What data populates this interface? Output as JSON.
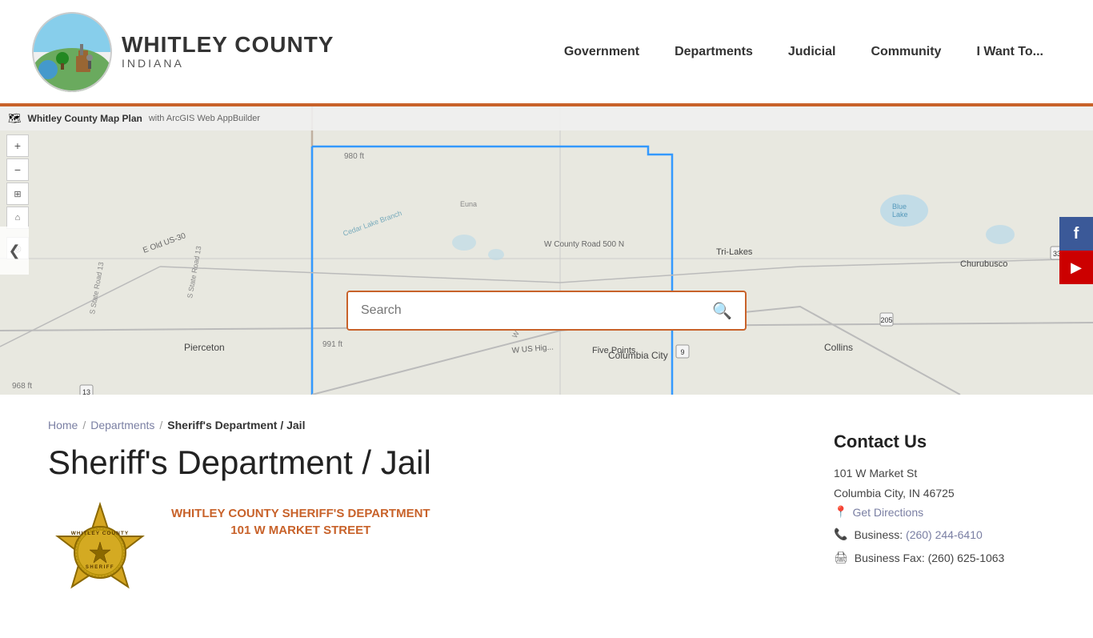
{
  "header": {
    "logo_county": "WHITLEY COUNTY",
    "logo_state": "INDIANA",
    "nav": [
      {
        "label": "Government",
        "href": "#"
      },
      {
        "label": "Departments",
        "href": "#"
      },
      {
        "label": "Judicial",
        "href": "#"
      },
      {
        "label": "Community",
        "href": "#"
      },
      {
        "label": "I Want To...",
        "href": "#"
      }
    ]
  },
  "map": {
    "arcgis_title": "Whitley County Map Plan",
    "arcgis_subtitle": "with ArcGIS Web AppBuilder",
    "prev_arrow": "❮",
    "zoom_in": "+",
    "zoom_out": "−",
    "controls": [
      "＋",
      "−",
      "⊞",
      "⌂"
    ],
    "social": {
      "facebook": "f",
      "youtube": "▶"
    }
  },
  "search": {
    "placeholder": "Search",
    "button_label": "🔍"
  },
  "breadcrumb": {
    "home": "Home",
    "departments": "Departments",
    "current": "Sheriff's Department / Jail"
  },
  "page": {
    "title": "Sheriff's Department / Jail",
    "dept_name_line1": "WHITLEY COUNTY SHERIFF'S DEPARTMENT",
    "dept_name_line2": "101 W MARKET STREET"
  },
  "contact": {
    "title": "Contact Us",
    "address_line1": "101 W Market St",
    "address_line2": "Columbia City, IN 46725",
    "directions_label": "Get Directions",
    "business_phone_label": "Business:",
    "business_phone": "(260) 244-6410",
    "fax_label": "Business Fax:",
    "fax": "(260) 625-1063"
  }
}
